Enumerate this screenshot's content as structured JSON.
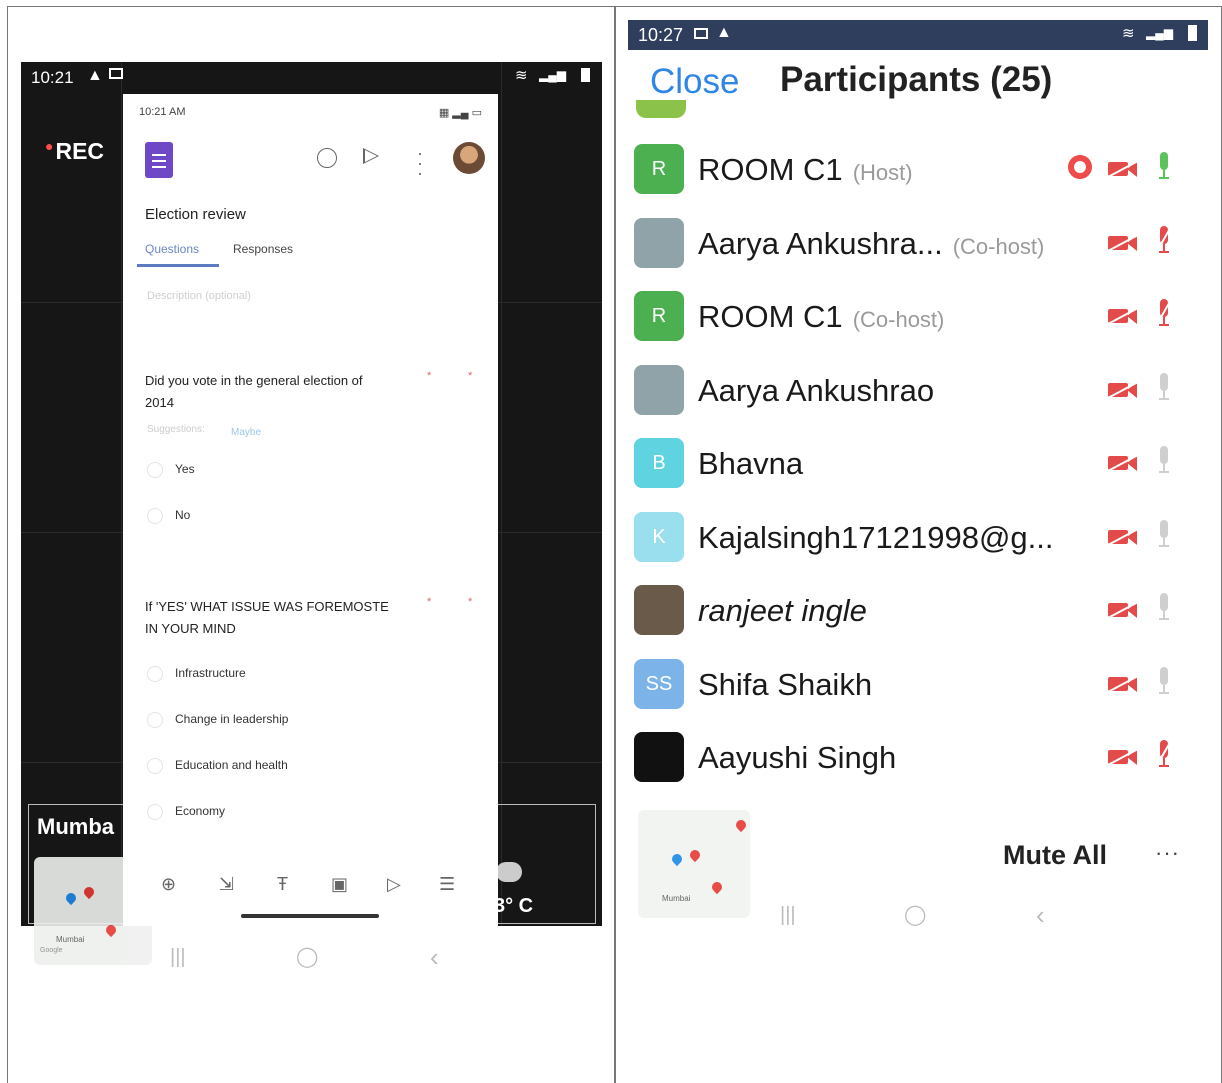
{
  "left_phone": {
    "status_time": "10:21",
    "rec_label": "REC",
    "location_label": "Mumba",
    "temp_fragment": "3° C",
    "map_label": "Mumbai",
    "map_google": "Google",
    "nav_recents": "|||",
    "nav_home": "◯",
    "nav_back": "‹",
    "forms": {
      "status_time": "10:21 AM",
      "title": "Election review",
      "tabs": [
        "Questions",
        "Responses"
      ],
      "description_placeholder": "Description (optional)",
      "questions": [
        {
          "text_line1": "Did you vote in the general election of",
          "text_line2": "2014",
          "required_mark": "*",
          "suggestions_label": "Suggestions:",
          "suggestion": "Maybe",
          "options": [
            "Yes",
            "No"
          ]
        },
        {
          "text_line1": "If 'YES' WHAT ISSUE WAS FOREMOSTE",
          "text_line2": "IN YOUR MIND",
          "required_mark": "*",
          "options": [
            "Infrastructure",
            "Change in leadership",
            "Education and health",
            "Economy"
          ]
        }
      ],
      "toolbar_icons": [
        "add-question-icon",
        "import-questions-icon",
        "add-title-icon",
        "add-image-icon",
        "add-video-icon",
        "add-section-icon"
      ]
    }
  },
  "right_phone": {
    "status_time": "10:27",
    "close_label": "Close",
    "title": "Participants (25)",
    "participants": [
      {
        "initials": "R",
        "name": "ROOM C1",
        "role": "(Host)",
        "avatar_color": "#4caf50",
        "recording": true,
        "video_off": true,
        "mic": "on"
      },
      {
        "initials": "",
        "name": "Aarya Ankushra...",
        "role": "(Co-host)",
        "avatar_color": "#8fa3a8",
        "recording": false,
        "video_off": true,
        "mic": "muted"
      },
      {
        "initials": "R",
        "name": "ROOM C1",
        "role": "(Co-host)",
        "avatar_color": "#4caf50",
        "recording": false,
        "video_off": true,
        "mic": "muted"
      },
      {
        "initials": "",
        "name": "Aarya Ankushrao",
        "role": "",
        "avatar_color": "#8fa3a8",
        "recording": false,
        "video_off": true,
        "mic": "off"
      },
      {
        "initials": "B",
        "name": "Bhavna",
        "role": "",
        "avatar_color": "#5fd3df",
        "recording": false,
        "video_off": true,
        "mic": "off"
      },
      {
        "initials": "K",
        "name": "Kajalsingh17121998@g...",
        "role": "",
        "avatar_color": "#9adfee",
        "recording": false,
        "video_off": true,
        "mic": "off"
      },
      {
        "initials": "",
        "name": "ranjeet ingle",
        "role": "",
        "avatar_color": "#6a5a4a",
        "recording": false,
        "video_off": true,
        "mic": "off"
      },
      {
        "initials": "SS",
        "name": "Shifa Shaikh",
        "role": "",
        "avatar_color": "#7cb4ea",
        "recording": false,
        "video_off": true,
        "mic": "off"
      },
      {
        "initials": "",
        "name": "Aayushi Singh",
        "role": "",
        "avatar_color": "#111111",
        "recording": false,
        "video_off": true,
        "mic": "muted"
      }
    ],
    "mute_all_label": "Mute All",
    "more_label": "···",
    "map_label": "Mumbai",
    "nav_recents": "|||",
    "nav_home": "◯",
    "nav_back": "‹"
  }
}
